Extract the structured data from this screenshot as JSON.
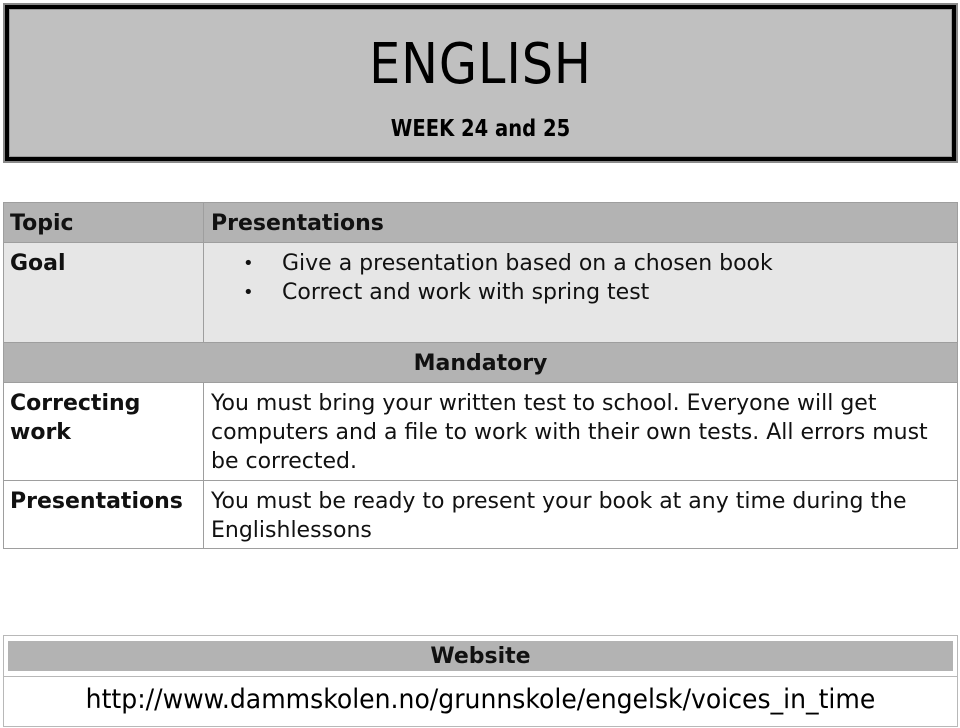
{
  "banner": {
    "title": "ENGLISH",
    "subtitle": "WEEK 24 and 25"
  },
  "table": {
    "topic": {
      "label": "Topic",
      "value": "Presentations"
    },
    "goal": {
      "label": "Goal",
      "items": [
        "Give a presentation based on a chosen book",
        "Correct and work with spring test"
      ]
    },
    "mandatory_header": "Mandatory",
    "correcting": {
      "label": "Correcting work",
      "value": "You must bring your written test to school. Everyone will get computers and a file to work with their own tests. All errors must be corrected."
    },
    "presentations": {
      "label": "Presentations",
      "value": "You must be ready to present your book at any time during the Englishlessons"
    }
  },
  "website": {
    "header": "Website",
    "url": "http://www.dammskolen.no/grunnskole/engelsk/voices_in_time"
  }
}
